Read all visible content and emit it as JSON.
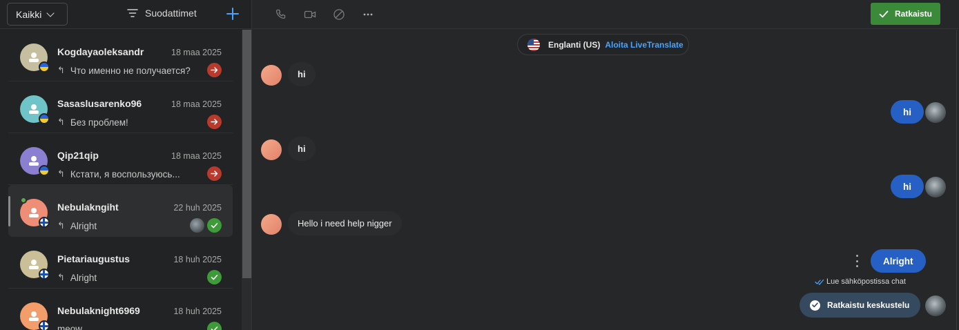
{
  "list_toolbar": {
    "filter_value": "Kaikki",
    "filters_label": "Suodattimet",
    "add_icon": "plus-icon"
  },
  "conversations": [
    {
      "name": "Kogdayaoleksandr",
      "date": "18 maa 2025",
      "message": "Что именно не получается?",
      "flag": "ukraine",
      "status": "arrow",
      "avatar_color": "#c6bf9f"
    },
    {
      "name": "Sasaslusarenko96",
      "date": "18 maa 2025",
      "message": "Без проблем!",
      "flag": "ukraine",
      "status": "arrow",
      "avatar_color": "#6ec4c6"
    },
    {
      "name": "Qip21qip",
      "date": "18 maa 2025",
      "message": "Кстати, я воспользуюсь...",
      "flag": "ukraine",
      "status": "arrow",
      "avatar_color": "#8a7fd0"
    },
    {
      "name": "Nebulakngiht",
      "date": "22 huh 2025",
      "message": "Alright",
      "flag": "finland",
      "status": "check",
      "avatar_color": "#ef8e76",
      "active": true,
      "online": true
    },
    {
      "name": "Pietariaugustus",
      "date": "18 huh 2025",
      "message": "Alright",
      "flag": "finland",
      "status": "check",
      "avatar_color": "#cbbf98"
    },
    {
      "name": "Nebulaknight6969",
      "date": "18 huh 2025",
      "message": "meow",
      "flag": "finland",
      "status": "check",
      "avatar_color": "#f29d6a"
    }
  ],
  "chat_toolbar": {
    "icons": [
      "phone-icon",
      "video-icon",
      "block-icon",
      "more-icon"
    ],
    "resolve_label": "Ratkaistu",
    "accent_color": "#3b8a3a"
  },
  "language": {
    "name": "Englanti (US)",
    "link": "Aloita LiveTranslate"
  },
  "messages": [
    {
      "side": "in",
      "text": "hi"
    },
    {
      "side": "out",
      "text": "hi"
    },
    {
      "side": "in",
      "text": "hi"
    },
    {
      "side": "out",
      "text": "hi"
    },
    {
      "side": "in",
      "text": "Hello i need help nigger"
    },
    {
      "side": "out",
      "text": "Alright"
    }
  ],
  "read_note": "Lue sähköpostissa chat",
  "system_event": "Ratkaistu keskustelu"
}
